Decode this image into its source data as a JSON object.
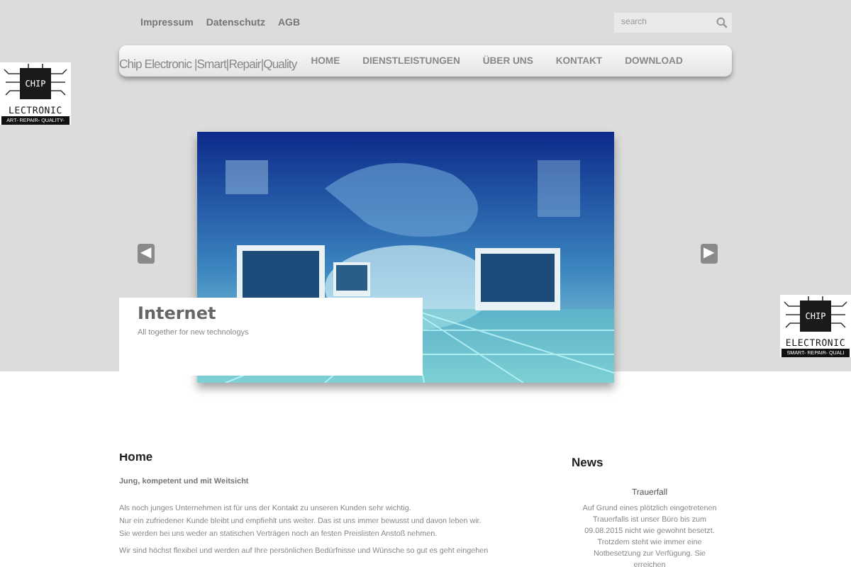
{
  "top_links": [
    "Impressum",
    "Datenschutz",
    "AGB"
  ],
  "search": {
    "placeholder": "search"
  },
  "site_title": "Chip Electronic |Smart|Repair|Quality",
  "nav": [
    "HOME",
    "DIENSTLEISTUNGEN",
    "ÜBER UNS",
    "KONTAKT",
    "DOWNLOAD"
  ],
  "logo_left": {
    "chip": "CHIP",
    "name": "LECTRONIC",
    "tagline": "ART- REPAIR- QUALITY-"
  },
  "logo_right": {
    "chip": "CHIP",
    "name": "ELECTRONIC",
    "tagline": "SMART- REPAIR- QUALI"
  },
  "slider": {
    "prev": "◀",
    "next": "▶",
    "caption_title": "Internet",
    "caption_text": "All together for new technologys"
  },
  "main": {
    "heading": "Home",
    "subheading": "Jung, kompetent und mit Weitsicht",
    "paragraph_lines": [
      "Als noch junges Unternehmen ist für uns der Kontakt zu unseren Kunden sehr wichtig.",
      "Nur ein zufriedener Kunde bleibt und empfiehlt uns weiter. Das ist uns immer bewusst und davon leben wir.",
      "Sie werden bei uns weder an statischen Verträgen noch an festen Preislisten Anstoß nehmen."
    ],
    "paragraph_2": "Wir sind höchst flexibel und werden auf Ihre persönlichen Bedürfnisse und Wünsche so gut es geht eingehen"
  },
  "news": {
    "heading": "News",
    "item_title": "Trauerfall",
    "item_text": "Auf Grund eines plötzlich eingetretenen Trauerfalls ist unser Büro bis zum 09.08.2015 nicht wie gewohnt besetzt. Trotzdem steht wie immer eine Notbesetzung zur Verfügung. Sie erreichen"
  }
}
